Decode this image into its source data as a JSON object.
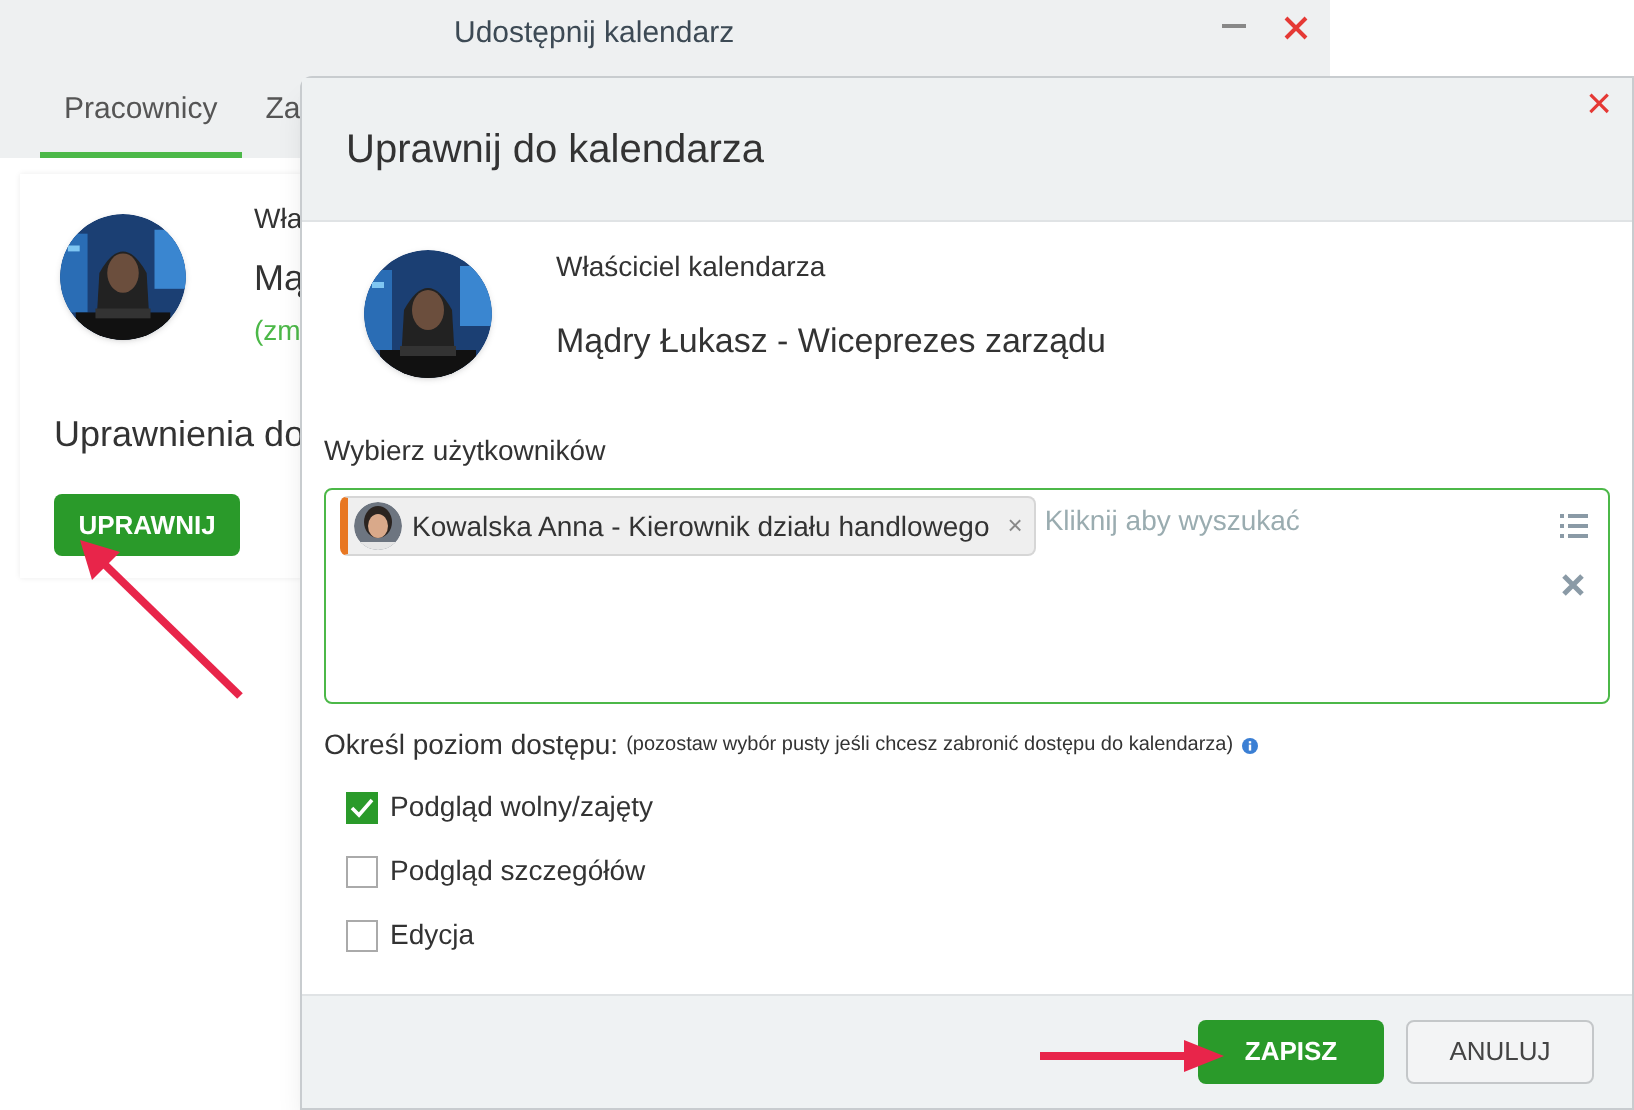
{
  "back_window": {
    "title": "Udostępnij kalendarz",
    "tabs": [
      {
        "label": "Pracownicy",
        "selected": true
      },
      {
        "label": "Za",
        "selected": false
      }
    ],
    "owner_label": "Wła",
    "owner_name": "Mą",
    "change_link": "(zm",
    "section_title": "Uprawnienia do",
    "grant_button": "UPRAWNIJ"
  },
  "dialog": {
    "title": "Uprawnij do kalendarza",
    "close": "×",
    "owner_label": "Właściciel kalendarza",
    "owner_name": "Mądry Łukasz - Wiceprezes zarządu",
    "users_label": "Wybierz użytkowników",
    "selected_users": [
      {
        "name": "Kowalska Anna - Kierownik działu handlowego",
        "remove": "×",
        "color": "#e87722"
      }
    ],
    "search": {
      "placeholder": "Kliknij aby wyszukać"
    },
    "access_label": "Określ poziom dostępu:",
    "access_note": "(pozostaw wybór pusty jeśli chcesz zabronić dostępu do kalendarza)",
    "access_levels": [
      {
        "label": "Podgląd wolny/zajęty",
        "checked": true
      },
      {
        "label": "Podgląd szczegółów",
        "checked": false
      },
      {
        "label": "Edycja",
        "checked": false
      }
    ],
    "buttons": [
      {
        "label": "ZAPISZ",
        "kind": "primary"
      },
      {
        "label": "ANULUJ",
        "kind": "secondary"
      }
    ]
  }
}
